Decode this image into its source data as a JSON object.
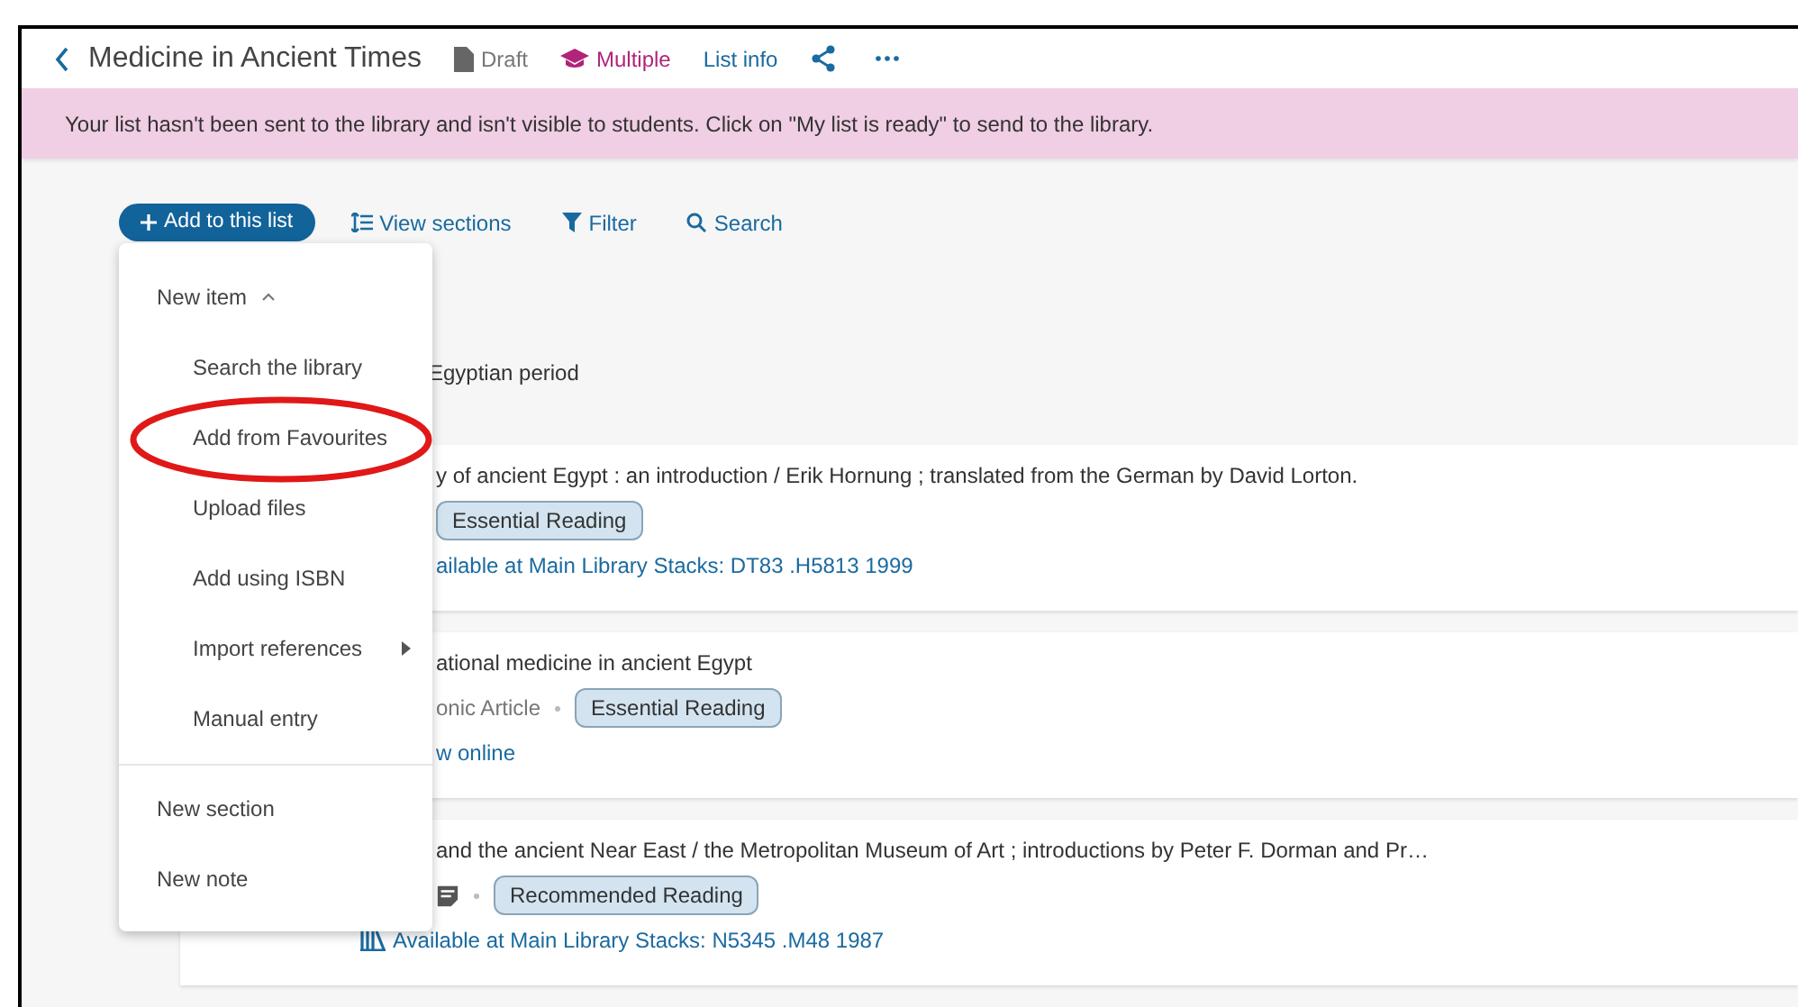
{
  "header": {
    "title": "Medicine in Ancient Times",
    "status": "Draft",
    "audience": "Multiple",
    "list_info": "List info"
  },
  "banner": {
    "text": "Your list hasn't been sent to the library and isn't visible to students. Click on \"My list is ready\" to send to the library."
  },
  "toolbar": {
    "add_button": "Add to this list",
    "view_sections": "View sections",
    "filter": "Filter",
    "search": "Search"
  },
  "menu": {
    "new_item": {
      "label": "New item",
      "expanded": true
    },
    "items": [
      {
        "label": "Search the library",
        "kind": "item"
      },
      {
        "label": "Add from Favourites",
        "kind": "item"
      },
      {
        "label": "Upload files",
        "kind": "item"
      },
      {
        "label": "Add using ISBN",
        "kind": "item"
      },
      {
        "label": "Import references",
        "kind": "submenu"
      },
      {
        "label": "Manual entry",
        "kind": "item"
      }
    ],
    "footer_items": [
      "New section",
      "New note"
    ]
  },
  "section_heading": "Egyptian period",
  "cards": [
    {
      "title": "y of ancient Egypt : an introduction / Erik Hornung ; translated from the German by David Lorton.",
      "meta": [
        {
          "kind": "tag",
          "text": "Essential Reading"
        }
      ],
      "link": {
        "text": "ailable at Main Library Stacks: DT83 .H5813 1999",
        "icon_shown": false
      }
    },
    {
      "title": "ational medicine in ancient Egypt",
      "meta": [
        {
          "kind": "text",
          "text": "onic Article"
        },
        {
          "kind": "tag",
          "text": "Essential Reading"
        }
      ],
      "link": {
        "text": "w online",
        "icon_shown": false
      }
    },
    {
      "title": "and the ancient Near East / the Metropolitan Museum of Art ; introductions by Peter F. Dorman and Pr…",
      "meta": [
        {
          "kind": "note"
        },
        {
          "kind": "tag",
          "text": "Recommended Reading"
        }
      ],
      "link": {
        "text": "Available at Main Library Stacks: N5345 .M48 1987",
        "icon_shown": true
      }
    }
  ]
}
